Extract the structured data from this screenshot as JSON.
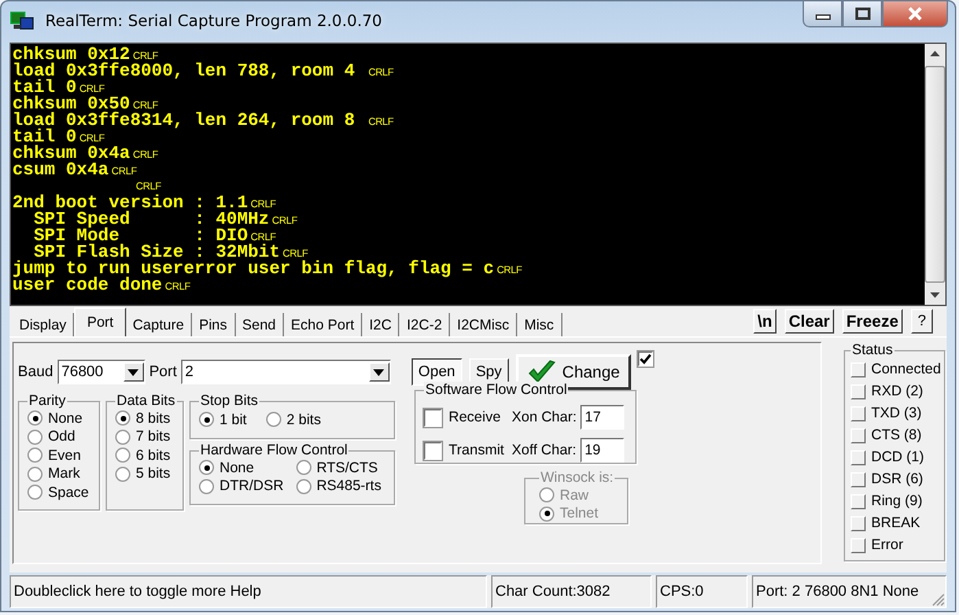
{
  "window": {
    "title": "RealTerm: Serial Capture Program 2.0.0.70"
  },
  "terminal": {
    "lines": [
      {
        "text": "chksum 0x12",
        "eol": "CRLF"
      },
      {
        "text": "load 0x3ffe8000, len 788, room 4 ",
        "eol": "CRLF"
      },
      {
        "text": "tail 0",
        "eol": "CRLF"
      },
      {
        "text": "chksum 0x50",
        "eol": "CRLF"
      },
      {
        "text": "load 0x3ffe8314, len 264, room 8 ",
        "eol": "CRLF"
      },
      {
        "text": "tail 0",
        "eol": "CRLF"
      },
      {
        "text": "chksum 0x4a",
        "eol": "CRLF"
      },
      {
        "text": "csum 0x4a",
        "eol": "CRLF"
      },
      {
        "eol": "CRLF"
      },
      {
        "text": "2nd boot version : 1.1",
        "eol": "CRLF"
      },
      {
        "text": "  SPI Speed      : 40MHz",
        "eol": "CRLF"
      },
      {
        "text": "  SPI Mode       : DIO",
        "eol": "CRLF"
      },
      {
        "text": "  SPI Flash Size : 32Mbit",
        "eol": "CRLF"
      },
      {
        "text": "jump to run usererror user bin flag, flag = c",
        "eol": "CRLF"
      },
      {
        "text": "user code done",
        "eol": "CRLF"
      }
    ]
  },
  "tabs": [
    {
      "label": "Display",
      "selected": false
    },
    {
      "label": "Port",
      "selected": true
    },
    {
      "label": "Capture",
      "selected": false
    },
    {
      "label": "Pins",
      "selected": false
    },
    {
      "label": "Send",
      "selected": false
    },
    {
      "label": "Echo Port",
      "selected": false
    },
    {
      "label": "I2C",
      "selected": false
    },
    {
      "label": "I2C-2",
      "selected": false
    },
    {
      "label": "I2CMisc",
      "selected": false
    },
    {
      "label": "Misc",
      "selected": false
    }
  ],
  "toolbar": [
    "\\n",
    "Clear",
    "Freeze",
    "?"
  ],
  "port_panel": {
    "baud": {
      "label": "Baud",
      "value": "76800"
    },
    "port": {
      "label": "Port",
      "value": "2"
    },
    "open_button": {
      "label": "Open",
      "pressed": true
    },
    "spy_button": {
      "label": "Spy"
    },
    "change_button": {
      "label": "Change"
    },
    "change_checkbox": {
      "checked": true
    },
    "parity": {
      "title": "Parity",
      "options": [
        {
          "label": "None",
          "selected": true
        },
        {
          "label": "Odd",
          "selected": false
        },
        {
          "label": "Even",
          "selected": false
        },
        {
          "label": "Mark",
          "selected": false
        },
        {
          "label": "Space",
          "selected": false
        }
      ]
    },
    "data_bits": {
      "title": "Data Bits",
      "options": [
        {
          "label": "8 bits",
          "selected": true
        },
        {
          "label": "7 bits",
          "selected": false
        },
        {
          "label": "6 bits",
          "selected": false
        },
        {
          "label": "5 bits",
          "selected": false
        }
      ]
    },
    "stop_bits": {
      "title": "Stop Bits",
      "options": [
        {
          "label": "1 bit",
          "selected": true
        },
        {
          "label": "2 bits",
          "selected": false
        }
      ]
    },
    "hardware_flow": {
      "title": "Hardware Flow Control",
      "options": [
        {
          "label": "None",
          "selected": true
        },
        {
          "label": "RTS/CTS",
          "selected": false
        },
        {
          "label": "DTR/DSR",
          "selected": false
        },
        {
          "label": "RS485-rts",
          "selected": false
        }
      ]
    },
    "software_flow": {
      "title": "Software Flow Control",
      "rows": [
        {
          "label": "Receive",
          "checked": false,
          "char_label": "Xon Char:",
          "char_value": "17"
        },
        {
          "label": "Transmit",
          "checked": false,
          "char_label": "Xoff Char:",
          "char_value": "19"
        }
      ]
    },
    "winsock": {
      "title": "Winsock is:",
      "disabled": true,
      "options": [
        {
          "label": "Raw",
          "selected": false
        },
        {
          "label": "Telnet",
          "selected": true
        }
      ]
    }
  },
  "status": {
    "title": "Status",
    "items": [
      {
        "label": "Connected",
        "on": false
      },
      {
        "label": "RXD (2)",
        "on": false
      },
      {
        "label": "TXD (3)",
        "on": false
      },
      {
        "label": "CTS (8)",
        "on": false
      },
      {
        "label": "DCD (1)",
        "on": false
      },
      {
        "label": "DSR (6)",
        "on": false
      },
      {
        "label": "Ring (9)",
        "on": false
      },
      {
        "label": "BREAK",
        "on": false
      },
      {
        "label": "Error",
        "on": false
      }
    ]
  },
  "status_bar": [
    {
      "text": "Doubleclick here to toggle more Help"
    },
    {
      "text": "Char Count:3082"
    },
    {
      "text": "CPS:0"
    },
    {
      "text": "Port: 2 76800 8N1 None"
    }
  ]
}
